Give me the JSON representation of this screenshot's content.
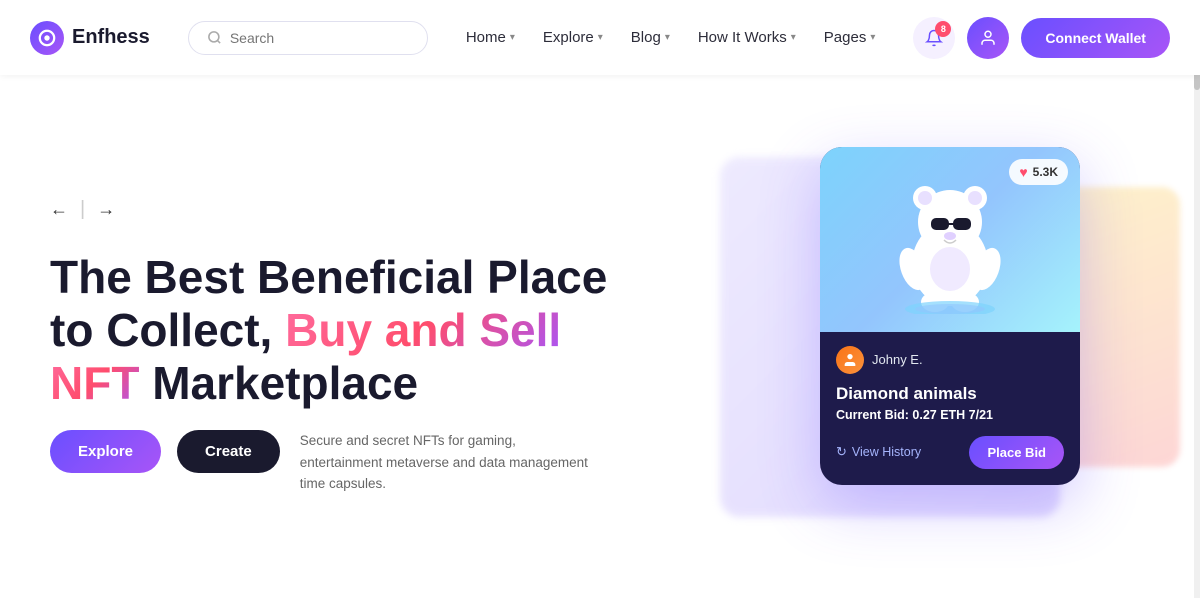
{
  "logo": {
    "icon_letter": "e",
    "text": "Enfhess"
  },
  "search": {
    "placeholder": "Search"
  },
  "nav": {
    "links": [
      {
        "label": "Home",
        "has_chevron": true
      },
      {
        "label": "Explore",
        "has_chevron": true
      },
      {
        "label": "Blog",
        "has_chevron": true
      },
      {
        "label": "How It Works",
        "has_chevron": true
      },
      {
        "label": "Pages",
        "has_chevron": true
      }
    ],
    "notification_count": "8",
    "connect_wallet_label": "Connect Wallet"
  },
  "hero": {
    "title_line1": "The Best Beneficial Place",
    "title_line2": "to Collect, ",
    "title_highlight": "Buy and Sell",
    "title_line3": "NFT",
    "title_line3b": " Marketplace",
    "description": "Secure and secret NFTs for gaming, entertainment metaverse and data management time capsules.",
    "explore_btn": "Explore",
    "create_btn": "Create"
  },
  "nft_card": {
    "like_count": "5.3K",
    "seller_name": "Johny E.",
    "title": "Diamond animals",
    "bid_label": "Current Bid:",
    "bid_value": "0.27 ETH 7/21",
    "view_history_label": "View History",
    "place_bid_label": "Place Bid"
  }
}
